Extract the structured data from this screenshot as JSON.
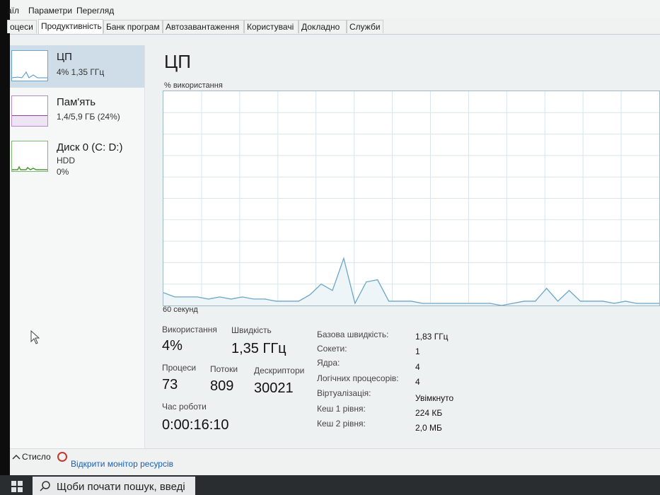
{
  "menu": [
    "аїл",
    "Параметри",
    "Перегляд"
  ],
  "tabs": [
    {
      "label": "оцеси",
      "active": false
    },
    {
      "label": "Продуктивність",
      "active": true
    },
    {
      "label": "Банк програм",
      "active": false
    },
    {
      "label": "Автозавантаження",
      "active": false
    },
    {
      "label": "Користувачі",
      "active": false
    },
    {
      "label": "Докладно",
      "active": false
    },
    {
      "label": "Служби",
      "active": false
    }
  ],
  "sidebar": {
    "items": [
      {
        "name": "ЦП",
        "line1": "4%  1,35 ГГц",
        "line2": "",
        "color": "#4a90c8",
        "selected": true
      },
      {
        "name": "Пам'ять",
        "line1": "1,4/5,9 ГБ (24%)",
        "line2": "",
        "color": "#8b3fa8",
        "selected": false
      },
      {
        "name": "Диск 0 (C: D:)",
        "line1": "HDD",
        "line2": "0%",
        "color": "#4d9a3a",
        "selected": false
      }
    ]
  },
  "main": {
    "title": "ЦП",
    "usage_label": "% використання",
    "time_label": "60 секунд",
    "graph_color": "#6aa6c8"
  },
  "chart_data": {
    "type": "line",
    "ylabel": "% використання",
    "xlabel": "60 секунд",
    "ylim": [
      0,
      100
    ],
    "values": [
      6,
      4,
      4,
      4,
      3,
      4,
      3,
      4,
      3,
      3,
      2,
      2,
      2,
      5,
      10,
      7,
      22,
      1,
      11,
      12,
      2,
      2,
      2,
      1,
      1,
      1,
      1,
      1,
      1,
      1,
      0,
      1,
      2,
      2,
      8,
      2,
      7,
      2,
      2,
      2,
      1,
      2,
      1,
      1,
      1
    ]
  },
  "stats": {
    "usage": {
      "label": "Використання",
      "value": "4%"
    },
    "speed": {
      "label": "Швидкість",
      "value": "1,35 ГГц"
    },
    "processes": {
      "label": "Процеси",
      "value": "73"
    },
    "threads": {
      "label": "Потоки",
      "value": "809"
    },
    "handles": {
      "label": "Дескриптори",
      "value": "30021"
    },
    "uptime": {
      "label": "Час роботи",
      "value": "0:00:16:10"
    }
  },
  "specs": [
    {
      "label": "Базова швидкість:",
      "value": "1,83 ГГц"
    },
    {
      "label": "Сокети:",
      "value": "1"
    },
    {
      "label": "Ядра:",
      "value": "4"
    },
    {
      "label": "Логічних процесорів:",
      "value": "4"
    },
    {
      "label": "Віртуалізація:",
      "value": "Увімкнуто"
    },
    {
      "label": "Кеш 1 рівня:",
      "value": "224 КБ"
    },
    {
      "label": "Кеш 2 рівня:",
      "value": "2,0 МБ"
    }
  ],
  "footer": {
    "fewer_details": "Стисло",
    "open_monitor": "Відкрити монітор ресурсів"
  },
  "taskbar": {
    "search_placeholder": "Щоби почати пошук, введі"
  }
}
